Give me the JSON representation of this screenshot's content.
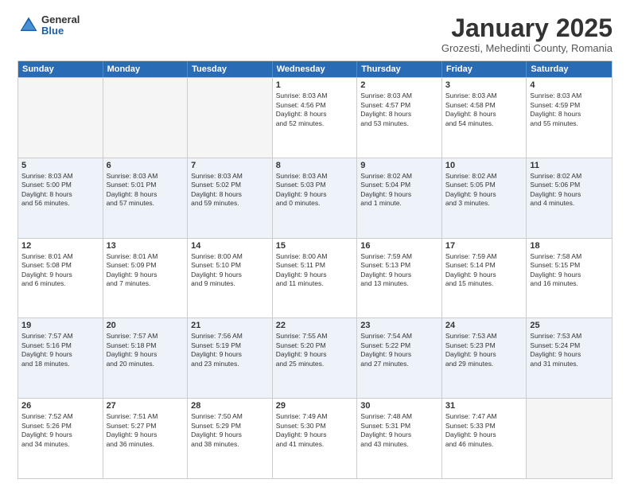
{
  "header": {
    "logo_general": "General",
    "logo_blue": "Blue",
    "month_title": "January 2025",
    "location": "Grozesti, Mehedinti County, Romania"
  },
  "weekdays": [
    "Sunday",
    "Monday",
    "Tuesday",
    "Wednesday",
    "Thursday",
    "Friday",
    "Saturday"
  ],
  "weeks": [
    [
      {
        "day": "",
        "text": "",
        "empty": true
      },
      {
        "day": "",
        "text": "",
        "empty": true
      },
      {
        "day": "",
        "text": "",
        "empty": true
      },
      {
        "day": "1",
        "text": "Sunrise: 8:03 AM\nSunset: 4:56 PM\nDaylight: 8 hours\nand 52 minutes.",
        "empty": false
      },
      {
        "day": "2",
        "text": "Sunrise: 8:03 AM\nSunset: 4:57 PM\nDaylight: 8 hours\nand 53 minutes.",
        "empty": false
      },
      {
        "day": "3",
        "text": "Sunrise: 8:03 AM\nSunset: 4:58 PM\nDaylight: 8 hours\nand 54 minutes.",
        "empty": false
      },
      {
        "day": "4",
        "text": "Sunrise: 8:03 AM\nSunset: 4:59 PM\nDaylight: 8 hours\nand 55 minutes.",
        "empty": false
      }
    ],
    [
      {
        "day": "5",
        "text": "Sunrise: 8:03 AM\nSunset: 5:00 PM\nDaylight: 8 hours\nand 56 minutes.",
        "empty": false
      },
      {
        "day": "6",
        "text": "Sunrise: 8:03 AM\nSunset: 5:01 PM\nDaylight: 8 hours\nand 57 minutes.",
        "empty": false
      },
      {
        "day": "7",
        "text": "Sunrise: 8:03 AM\nSunset: 5:02 PM\nDaylight: 8 hours\nand 59 minutes.",
        "empty": false
      },
      {
        "day": "8",
        "text": "Sunrise: 8:03 AM\nSunset: 5:03 PM\nDaylight: 9 hours\nand 0 minutes.",
        "empty": false
      },
      {
        "day": "9",
        "text": "Sunrise: 8:02 AM\nSunset: 5:04 PM\nDaylight: 9 hours\nand 1 minute.",
        "empty": false
      },
      {
        "day": "10",
        "text": "Sunrise: 8:02 AM\nSunset: 5:05 PM\nDaylight: 9 hours\nand 3 minutes.",
        "empty": false
      },
      {
        "day": "11",
        "text": "Sunrise: 8:02 AM\nSunset: 5:06 PM\nDaylight: 9 hours\nand 4 minutes.",
        "empty": false
      }
    ],
    [
      {
        "day": "12",
        "text": "Sunrise: 8:01 AM\nSunset: 5:08 PM\nDaylight: 9 hours\nand 6 minutes.",
        "empty": false
      },
      {
        "day": "13",
        "text": "Sunrise: 8:01 AM\nSunset: 5:09 PM\nDaylight: 9 hours\nand 7 minutes.",
        "empty": false
      },
      {
        "day": "14",
        "text": "Sunrise: 8:00 AM\nSunset: 5:10 PM\nDaylight: 9 hours\nand 9 minutes.",
        "empty": false
      },
      {
        "day": "15",
        "text": "Sunrise: 8:00 AM\nSunset: 5:11 PM\nDaylight: 9 hours\nand 11 minutes.",
        "empty": false
      },
      {
        "day": "16",
        "text": "Sunrise: 7:59 AM\nSunset: 5:13 PM\nDaylight: 9 hours\nand 13 minutes.",
        "empty": false
      },
      {
        "day": "17",
        "text": "Sunrise: 7:59 AM\nSunset: 5:14 PM\nDaylight: 9 hours\nand 15 minutes.",
        "empty": false
      },
      {
        "day": "18",
        "text": "Sunrise: 7:58 AM\nSunset: 5:15 PM\nDaylight: 9 hours\nand 16 minutes.",
        "empty": false
      }
    ],
    [
      {
        "day": "19",
        "text": "Sunrise: 7:57 AM\nSunset: 5:16 PM\nDaylight: 9 hours\nand 18 minutes.",
        "empty": false
      },
      {
        "day": "20",
        "text": "Sunrise: 7:57 AM\nSunset: 5:18 PM\nDaylight: 9 hours\nand 20 minutes.",
        "empty": false
      },
      {
        "day": "21",
        "text": "Sunrise: 7:56 AM\nSunset: 5:19 PM\nDaylight: 9 hours\nand 23 minutes.",
        "empty": false
      },
      {
        "day": "22",
        "text": "Sunrise: 7:55 AM\nSunset: 5:20 PM\nDaylight: 9 hours\nand 25 minutes.",
        "empty": false
      },
      {
        "day": "23",
        "text": "Sunrise: 7:54 AM\nSunset: 5:22 PM\nDaylight: 9 hours\nand 27 minutes.",
        "empty": false
      },
      {
        "day": "24",
        "text": "Sunrise: 7:53 AM\nSunset: 5:23 PM\nDaylight: 9 hours\nand 29 minutes.",
        "empty": false
      },
      {
        "day": "25",
        "text": "Sunrise: 7:53 AM\nSunset: 5:24 PM\nDaylight: 9 hours\nand 31 minutes.",
        "empty": false
      }
    ],
    [
      {
        "day": "26",
        "text": "Sunrise: 7:52 AM\nSunset: 5:26 PM\nDaylight: 9 hours\nand 34 minutes.",
        "empty": false
      },
      {
        "day": "27",
        "text": "Sunrise: 7:51 AM\nSunset: 5:27 PM\nDaylight: 9 hours\nand 36 minutes.",
        "empty": false
      },
      {
        "day": "28",
        "text": "Sunrise: 7:50 AM\nSunset: 5:29 PM\nDaylight: 9 hours\nand 38 minutes.",
        "empty": false
      },
      {
        "day": "29",
        "text": "Sunrise: 7:49 AM\nSunset: 5:30 PM\nDaylight: 9 hours\nand 41 minutes.",
        "empty": false
      },
      {
        "day": "30",
        "text": "Sunrise: 7:48 AM\nSunset: 5:31 PM\nDaylight: 9 hours\nand 43 minutes.",
        "empty": false
      },
      {
        "day": "31",
        "text": "Sunrise: 7:47 AM\nSunset: 5:33 PM\nDaylight: 9 hours\nand 46 minutes.",
        "empty": false
      },
      {
        "day": "",
        "text": "",
        "empty": true
      }
    ]
  ]
}
